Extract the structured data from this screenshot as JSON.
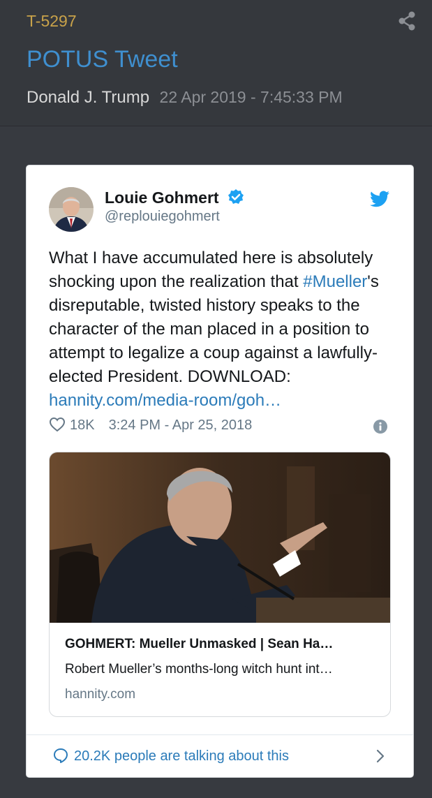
{
  "post": {
    "id": "T-5297",
    "title": "POTUS Tweet",
    "author": "Donald J. Trump",
    "timestamp": "22 Apr 2019 - 7:45:33 PM"
  },
  "tweet": {
    "name": "Louie Gohmert",
    "handle": "@replouiegohmert",
    "text_lines": [
      "What I have accumulated here is absolutely",
      "shocking upon the realization that ",
      "disreputable, twisted history speaks to the",
      "character of the man placed in a position to",
      "attempt to legalize a coup against a lawfully-",
      "elected President. DOWNLOAD:"
    ],
    "hashtag": "#Mueller",
    "hashtag_suffix": "'s",
    "link": "hannity.com/media-room/goh…",
    "likes": "18K",
    "time": "3:24 PM - Apr 25, 2018",
    "card": {
      "title": "GOHMERT: Mueller Unmasked | Sean Ha…",
      "description": "Robert Mueller’s months-long witch hunt int…",
      "domain": "hannity.com"
    },
    "conversation": "20.2K people are talking about this"
  },
  "colors": {
    "page_bg": "#373a40",
    "post_id": "#c8a24a",
    "title": "#3f8fcf",
    "twitter_blue": "#1da1f2",
    "link": "#2b7bb9"
  },
  "icons": {
    "share": "share-icon",
    "verified": "verified-badge-icon",
    "bird": "twitter-bird-icon",
    "heart": "heart-icon",
    "info": "info-icon",
    "bubble": "speech-bubble-icon",
    "chevron": "chevron-right-icon"
  }
}
